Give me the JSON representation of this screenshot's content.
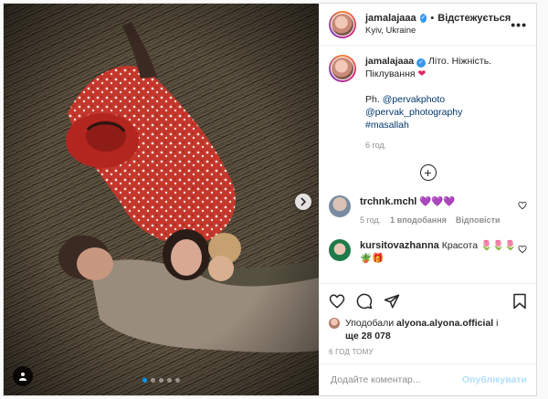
{
  "post": {
    "author": {
      "username": "jamalajaaa",
      "separator": "•",
      "follow_state": "Відстежується",
      "location": "Kyiv, Ukraine",
      "more_label": "•••"
    },
    "caption": {
      "username": "jamalajaaa",
      "text": "Літо. Ніжність. Піклування",
      "emoji": "❤",
      "photo_credit": "Ph.",
      "mention_1": "@pervakphoto",
      "mention_2": "@pervak_photography",
      "hashtag": "#masallah",
      "time": "6 год."
    },
    "comments": [
      {
        "username": "trchnk.mchl",
        "text": "💜💜💜",
        "time": "5 год.",
        "likes": "1 вподобання",
        "reply": "Відповісти"
      },
      {
        "username": "kursitovazhanna",
        "text": "Красота 🌷🌷🌷",
        "text2": "🪴🎁"
      }
    ],
    "likes_line": {
      "prefix": "Уподобали",
      "user": "alyona.alyona.official",
      "suffix": "і",
      "count": "ще 28 078"
    },
    "posted_ago": "6 ГОД ТОМУ",
    "add_comment_placeholder": "Додайте коментар...",
    "publish_label": "Опублікувати",
    "carousel": {
      "total": 5,
      "active": 0
    }
  },
  "icons": [
    "more-icon",
    "verified-icon",
    "heart-icon",
    "comment-icon",
    "share-icon",
    "save-icon",
    "next-arrow-icon",
    "tag-user-icon",
    "load-more-icon"
  ],
  "colors": {
    "accent": "#0095f6",
    "verified": "#3897f0",
    "publish_disabled": "#b2dffc",
    "muted": "#8e8e8e"
  }
}
